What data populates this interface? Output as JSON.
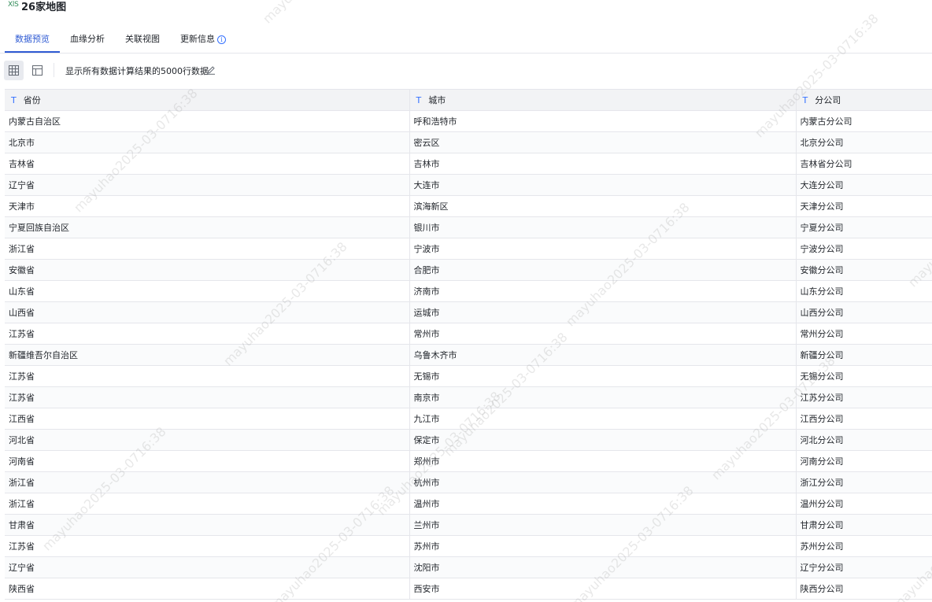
{
  "file": {
    "icon_text": "XlS",
    "title": "26家地图"
  },
  "tabs": [
    {
      "label": "数据预览",
      "active": true
    },
    {
      "label": "血缘分析",
      "active": false
    },
    {
      "label": "关联视图",
      "active": false
    },
    {
      "label": "更新信息",
      "active": false
    }
  ],
  "toolbar": {
    "grid_view_icon": "grid-icon",
    "layout_view_icon": "layout-icon",
    "summary": "显示所有数据计算结果的5000行数据",
    "edit_icon": "pencil-icon"
  },
  "table": {
    "column_type_icon": "T",
    "columns": [
      "省份",
      "城市",
      "分公司"
    ],
    "rows": [
      [
        "内蒙古自治区",
        "呼和浩特市",
        "内蒙古分公司"
      ],
      [
        "北京市",
        "密云区",
        "北京分公司"
      ],
      [
        "吉林省",
        "吉林市",
        "吉林省分公司"
      ],
      [
        "辽宁省",
        "大连市",
        "大连分公司"
      ],
      [
        "天津市",
        "滨海新区",
        "天津分公司"
      ],
      [
        "宁夏回族自治区",
        "银川市",
        "宁夏分公司"
      ],
      [
        "浙江省",
        "宁波市",
        "宁波分公司"
      ],
      [
        "安徽省",
        "合肥市",
        "安徽分公司"
      ],
      [
        "山东省",
        "济南市",
        "山东分公司"
      ],
      [
        "山西省",
        "运城市",
        "山西分公司"
      ],
      [
        "江苏省",
        "常州市",
        "常州分公司"
      ],
      [
        "新疆维吾尔自治区",
        "乌鲁木齐市",
        "新疆分公司"
      ],
      [
        "江苏省",
        "无锡市",
        "无锡分公司"
      ],
      [
        "江苏省",
        "南京市",
        "江苏分公司"
      ],
      [
        "江西省",
        "九江市",
        "江西分公司"
      ],
      [
        "河北省",
        "保定市",
        "河北分公司"
      ],
      [
        "河南省",
        "郑州市",
        "河南分公司"
      ],
      [
        "浙江省",
        "杭州市",
        "浙江分公司"
      ],
      [
        "浙江省",
        "温州市",
        "温州分公司"
      ],
      [
        "甘肃省",
        "兰州市",
        "甘肃分公司"
      ],
      [
        "江苏省",
        "苏州市",
        "苏州分公司"
      ],
      [
        "辽宁省",
        "沈阳市",
        "辽宁分公司"
      ],
      [
        "陕西省",
        "西安市",
        "陕西分公司"
      ]
    ]
  },
  "watermark": "mayuhao2025-03-0716:38",
  "colors": {
    "accent": "#2f5bd3",
    "header_bg": "#f2f3f5",
    "border": "#e5e6eb"
  }
}
